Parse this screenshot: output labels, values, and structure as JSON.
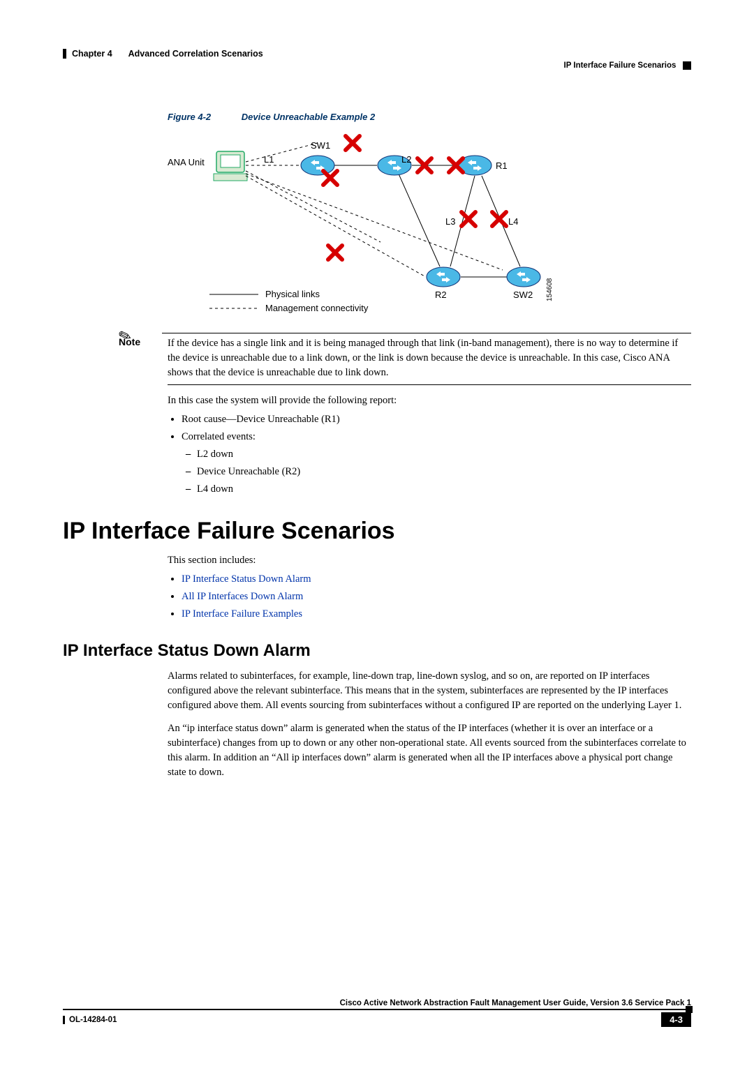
{
  "header": {
    "chapter_label": "Chapter 4",
    "chapter_title": "Advanced Correlation Scenarios",
    "section_breadcrumb": "IP Interface Failure Scenarios"
  },
  "figure": {
    "label": "Figure 4-2",
    "title": "Device Unreachable Example 2",
    "labels": {
      "ana_unit": "ANA Unit",
      "sw1": "SW1",
      "sw2": "SW2",
      "r1": "R1",
      "r2": "R2",
      "l1": "L1",
      "l2": "L2",
      "l3": "L3",
      "l4": "L4",
      "physical": "Physical links",
      "mgmt": "Management connectivity",
      "id": "154608"
    }
  },
  "note": {
    "label": "Note",
    "text": "If the device has a single link and it is being managed through that link (in-band management), there is no way to determine if the device is unreachable due to a link down, or the link is down because the device is unreachable. In this case, Cisco ANA shows that the device is unreachable due to link down."
  },
  "report": {
    "intro": "In this case the system will provide the following report:",
    "root_cause": "Root cause—Device Unreachable (R1)",
    "correlated_label": "Correlated events:",
    "correlated": {
      "c1": "L2 down",
      "c2": "Device Unreachable (R2)",
      "c3": "L4 down"
    }
  },
  "section": {
    "heading": "IP Interface Failure Scenarios",
    "intro": "This section includes:",
    "links": {
      "l1": "IP Interface Status Down Alarm",
      "l2": "All IP Interfaces Down Alarm",
      "l3": "IP Interface Failure Examples"
    }
  },
  "subsection": {
    "heading": "IP Interface Status Down Alarm",
    "p1": "Alarms related to subinterfaces, for example, line-down trap,  line-down syslog, and so on, are reported on IP interfaces configured above the relevant subinterface. This means that in the system, subinterfaces are represented by the IP interfaces configured above them. All events sourcing from subinterfaces without a configured IP are reported on the underlying Layer 1.",
    "p2": "An “ip interface status down” alarm is generated when the status of the IP interfaces (whether it is over an interface or a subinterface) changes from up to down or any other non-operational state. All events sourced from the subinterfaces correlate to this alarm. In addition an “All ip interfaces down” alarm is generated when all the IP interfaces above a physical port change state to down."
  },
  "footer": {
    "guide_title": "Cisco Active Network Abstraction Fault Management User Guide, Version 3.6 Service Pack 1",
    "doc_id": "OL-14284-01",
    "page_num": "4-3"
  }
}
